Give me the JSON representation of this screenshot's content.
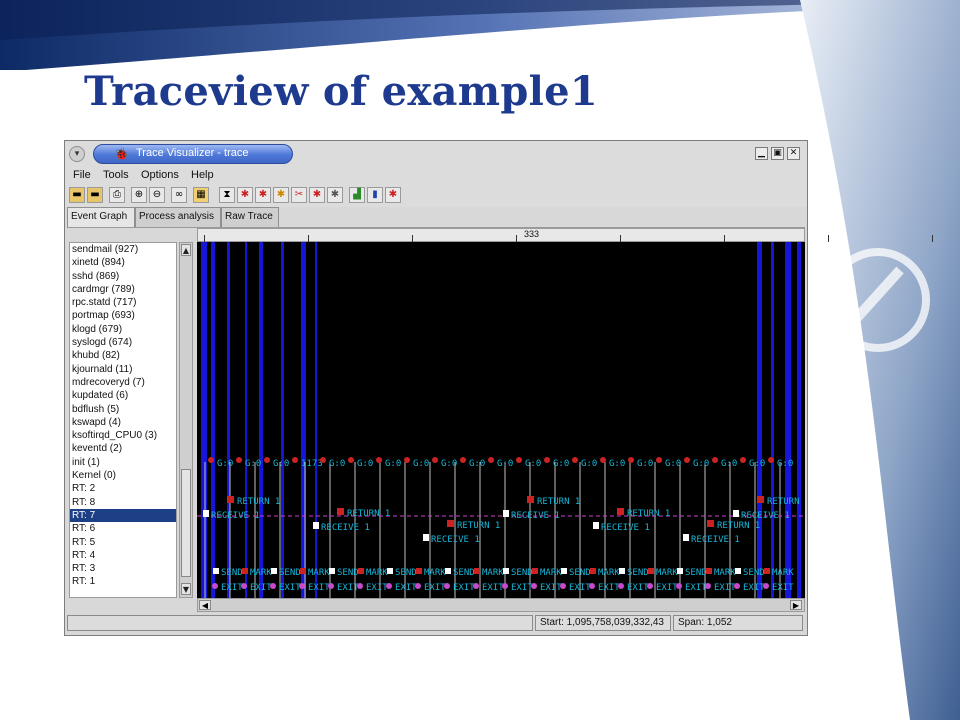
{
  "slide": {
    "title": "Traceview of example1"
  },
  "window": {
    "title": "Trace Visualizer - trace",
    "controls": {
      "minimize": "▁",
      "maximize": "▣",
      "close": "✕"
    }
  },
  "menu": [
    "File",
    "Tools",
    "Options",
    "Help"
  ],
  "toolbar": {
    "icons": [
      "open-folder-icon",
      "open-folder-alt-icon",
      "print-icon",
      "zoom-in-icon",
      "zoom-out-icon",
      "binoculars-icon",
      "color-chart-icon",
      "filter-icon",
      "bug-filter-icon",
      "bug-red-icon",
      "bug-yellow-icon",
      "bug-cut-icon",
      "bug-multi-icon",
      "bug-grid-icon",
      "graph-icon",
      "bar-chart-icon",
      "bug-settings-icon"
    ]
  },
  "tabs": [
    "Event Graph",
    "Process analysis",
    "Raw Trace"
  ],
  "processes": [
    "sendmail (927)",
    "xinetd (894)",
    "sshd (869)",
    "cardmgr (789)",
    "rpc.statd (717)",
    "portmap (693)",
    "klogd (679)",
    "syslogd (674)",
    "khubd (82)",
    "kjournald (11)",
    "mdrecoveryd (7)",
    "kupdated (6)",
    "bdflush (5)",
    "kswapd (4)",
    "ksoftirqd_CPU0 (3)",
    "keventd (2)",
    "init (1)",
    "Kernel (0)",
    "RT: 2",
    "RT: 8",
    "RT: 7",
    "RT: 6",
    "RT: 5",
    "RT: 4",
    "RT: 3",
    "RT: 1"
  ],
  "selected_process": "RT: 7",
  "ruler": {
    "label": "333"
  },
  "graph": {
    "labels": {
      "top": "G:0",
      "top_alt": "1173",
      "return": "RETURN 1",
      "receive": "RECEIVE 1",
      "send": "SEND",
      "mark": "MARK",
      "exit": "EXIT"
    },
    "colors": {
      "background": "#000000",
      "line": "#1a1aff",
      "label": "#18b6d8",
      "event": "#cc2222"
    }
  },
  "status": {
    "start": "Start: 1,095,758,039,332,43",
    "span": "Span: 1,052"
  }
}
